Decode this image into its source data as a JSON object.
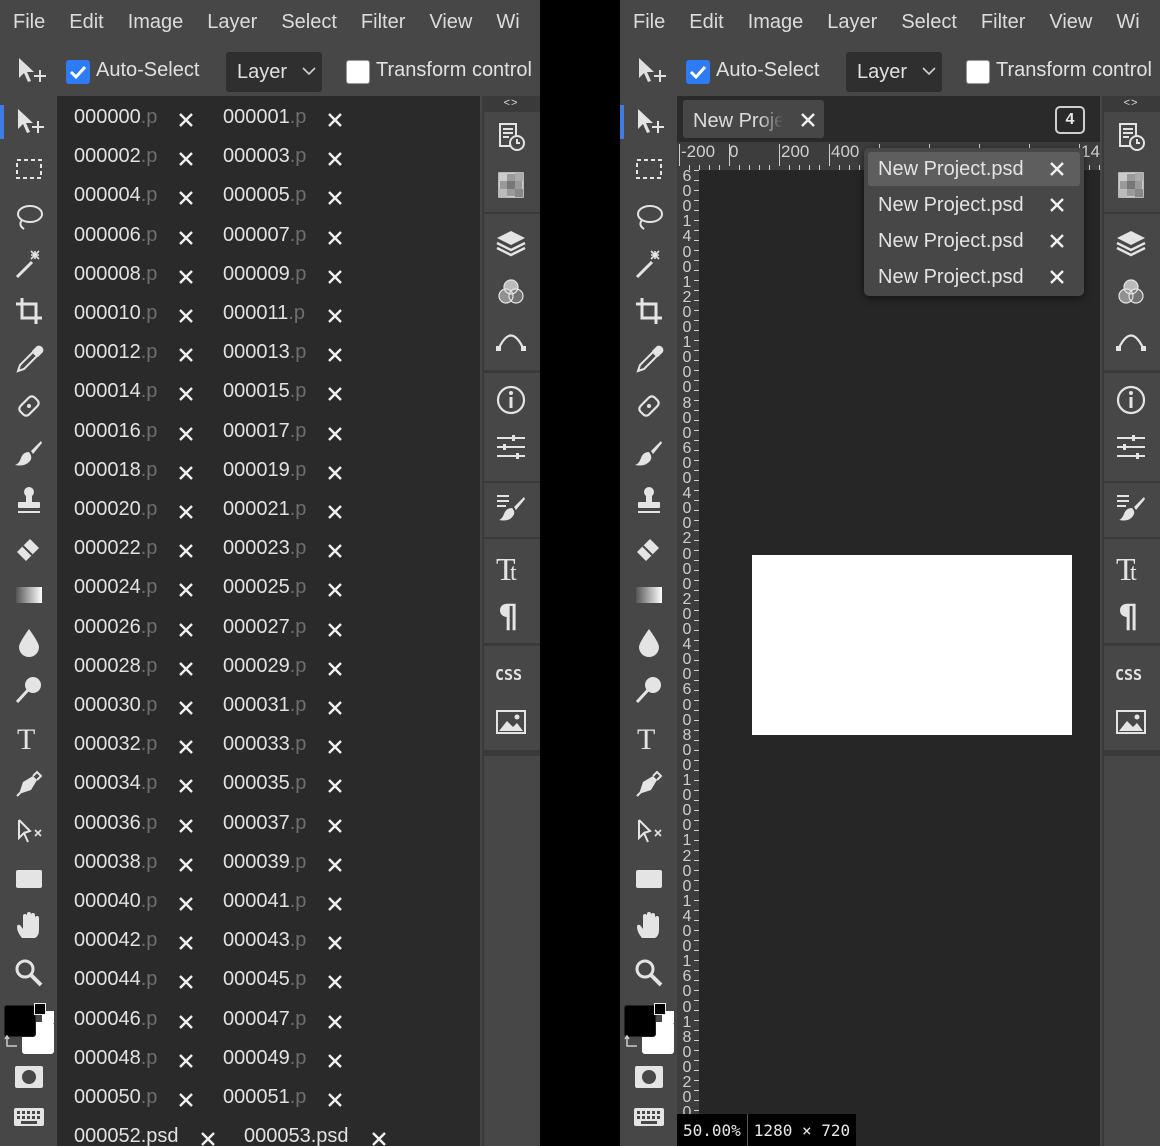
{
  "menu": [
    "File",
    "Edit",
    "Image",
    "Layer",
    "Select",
    "Filter",
    "View",
    "Wi"
  ],
  "options": {
    "auto_select_label": "Auto-Select",
    "auto_select_checked": true,
    "layer_select_value": "Layer",
    "transform_controls_label": "Transform control",
    "transform_checked": false
  },
  "left_documents": {
    "files": [
      [
        "000000",
        ".p"
      ],
      [
        "000001",
        ".p"
      ],
      [
        "000002",
        ".p"
      ],
      [
        "000003",
        ".p"
      ],
      [
        "000004",
        ".p"
      ],
      [
        "000005",
        ".p"
      ],
      [
        "000006",
        ".p"
      ],
      [
        "000007",
        ".p"
      ],
      [
        "000008",
        ".p"
      ],
      [
        "000009",
        ".p"
      ],
      [
        "000010",
        ".p"
      ],
      [
        "000011",
        ".p"
      ],
      [
        "000012",
        ".p"
      ],
      [
        "000013",
        ".p"
      ],
      [
        "000014",
        ".p"
      ],
      [
        "000015",
        ".p"
      ],
      [
        "000016",
        ".p"
      ],
      [
        "000017",
        ".p"
      ],
      [
        "000018",
        ".p"
      ],
      [
        "000019",
        ".p"
      ],
      [
        "000020",
        ".p"
      ],
      [
        "000021",
        ".p"
      ],
      [
        "000022",
        ".p"
      ],
      [
        "000023",
        ".p"
      ],
      [
        "000024",
        ".p"
      ],
      [
        "000025",
        ".p"
      ],
      [
        "000026",
        ".p"
      ],
      [
        "000027",
        ".p"
      ],
      [
        "000028",
        ".p"
      ],
      [
        "000029",
        ".p"
      ],
      [
        "000030",
        ".p"
      ],
      [
        "000031",
        ".p"
      ],
      [
        "000032",
        ".p"
      ],
      [
        "000033",
        ".p"
      ],
      [
        "000034",
        ".p"
      ],
      [
        "000035",
        ".p"
      ],
      [
        "000036",
        ".p"
      ],
      [
        "000037",
        ".p"
      ],
      [
        "000038",
        ".p"
      ],
      [
        "000039",
        ".p"
      ],
      [
        "000040",
        ".p"
      ],
      [
        "000041",
        ".p"
      ],
      [
        "000042",
        ".p"
      ],
      [
        "000043",
        ".p"
      ],
      [
        "000044",
        ".p"
      ],
      [
        "000045",
        ".p"
      ],
      [
        "000046",
        ".p"
      ],
      [
        "000047",
        ".p"
      ],
      [
        "000048",
        ".p"
      ],
      [
        "000049",
        ".p"
      ],
      [
        "000050",
        ".p"
      ],
      [
        "000051",
        ".p"
      ],
      [
        "000052",
        ".psd"
      ],
      [
        "000053",
        ".psd"
      ]
    ]
  },
  "right_editor": {
    "tab_title": "New Project.psd",
    "tab_count": "4",
    "hruler_labels": [
      "-200",
      "0",
      "200",
      "400",
      "14"
    ],
    "vruler_labels": [
      "6",
      "0",
      "0",
      "1",
      "4",
      "0",
      "0",
      "1",
      "2",
      "0",
      "0",
      "1",
      "0",
      "0",
      "0",
      "8",
      "0",
      "0",
      "6",
      "0",
      "0",
      "4",
      "0",
      "0",
      "2",
      "0",
      "0",
      "0",
      "2",
      "0",
      "0",
      "4",
      "0",
      "0",
      "6",
      "0",
      "0",
      "8",
      "0",
      "0",
      "1",
      "0",
      "0",
      "0",
      "1",
      "2",
      "0",
      "0",
      "1",
      "4",
      "0",
      "0",
      "1",
      "6",
      "0",
      "0",
      "1",
      "8",
      "0",
      "0",
      "2",
      "0",
      "0",
      "0",
      "2"
    ],
    "open_docs_menu": [
      {
        "label": "New Project.psd",
        "highlighted": true
      },
      {
        "label": "New Project.psd",
        "highlighted": false
      },
      {
        "label": "New Project.psd",
        "highlighted": false
      },
      {
        "label": "New Project.psd",
        "highlighted": false
      }
    ],
    "status": {
      "zoom": "50.00%",
      "size": "1280 × 720"
    }
  },
  "panel_toggle": "<>",
  "colors": {
    "accent": "#2d7cf6",
    "ui_bg": "#474747",
    "panel_bg": "#2a2a2a"
  },
  "tools": [
    "move-tool",
    "marquee-tool",
    "lasso-tool",
    "magic-wand-tool",
    "crop-tool",
    "eyedropper-tool",
    "healing-tool",
    "brush-tool",
    "stamp-tool",
    "eraser-tool",
    "gradient-tool",
    "blur-tool",
    "dodge-tool",
    "type-tool",
    "pen-tool",
    "path-select-tool",
    "shape-tool",
    "hand-tool",
    "zoom-tool"
  ],
  "right_panel_icons": [
    "history-icon",
    "swatches-icon",
    "layers-icon",
    "channels-icon",
    "paths-icon",
    "info-icon",
    "properties-icon",
    "brushes-icon",
    "character-icon",
    "paragraph-icon",
    "css-icon",
    "image-icon"
  ],
  "css_label": "CSS"
}
